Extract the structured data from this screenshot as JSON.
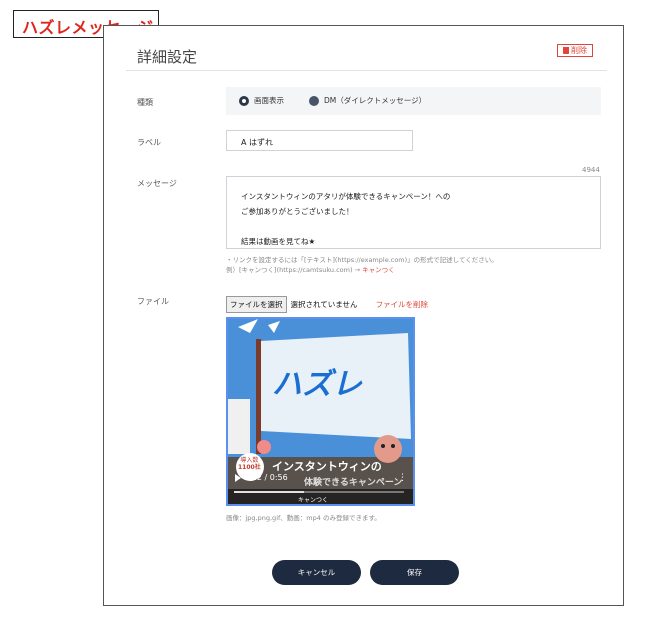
{
  "header_tag": "ハズレメッセージ",
  "title": "詳細設定",
  "delete_label": "削除",
  "type": {
    "label": "種類",
    "options": [
      {
        "label": "画面表示",
        "selected": true
      },
      {
        "label": "DM（ダイレクトメッセージ）",
        "selected": false
      }
    ]
  },
  "label_field": {
    "label": "ラベル",
    "value": "A はずれ"
  },
  "message": {
    "label": "メッセージ",
    "count": "4944",
    "lines": [
      "インスタントウィンのアタリが体験できるキャンペーン！への",
      "ご参加ありがとうございました！",
      "",
      "結果は動画を見てね★"
    ],
    "help_line1": "・リンクを設定するには「[テキスト](https://example.com)」の形式で記述してください。",
    "help_line2_prefix": "例）[キャンつく](https://camtsuku.com) → ",
    "help_line2_link": "キャンつく"
  },
  "file": {
    "label": "ファイル",
    "choose_label": "ファイルを選択",
    "none_label": "選択されていません",
    "delete_label": "ファイルを削除",
    "video": {
      "banner_text": "ハズレ",
      "caption": "インスタントウィンの",
      "caption2": "体験できるキャンペーン",
      "badge_line1": "導入数",
      "badge_line2": "1100社",
      "time": "0:22 / 0:56",
      "brand": "キャンつく"
    },
    "note": "画像：jpg,png,gif、動画：mp4 のみ登録できます。"
  },
  "buttons": {
    "cancel": "キャンセル",
    "save": "保存"
  }
}
